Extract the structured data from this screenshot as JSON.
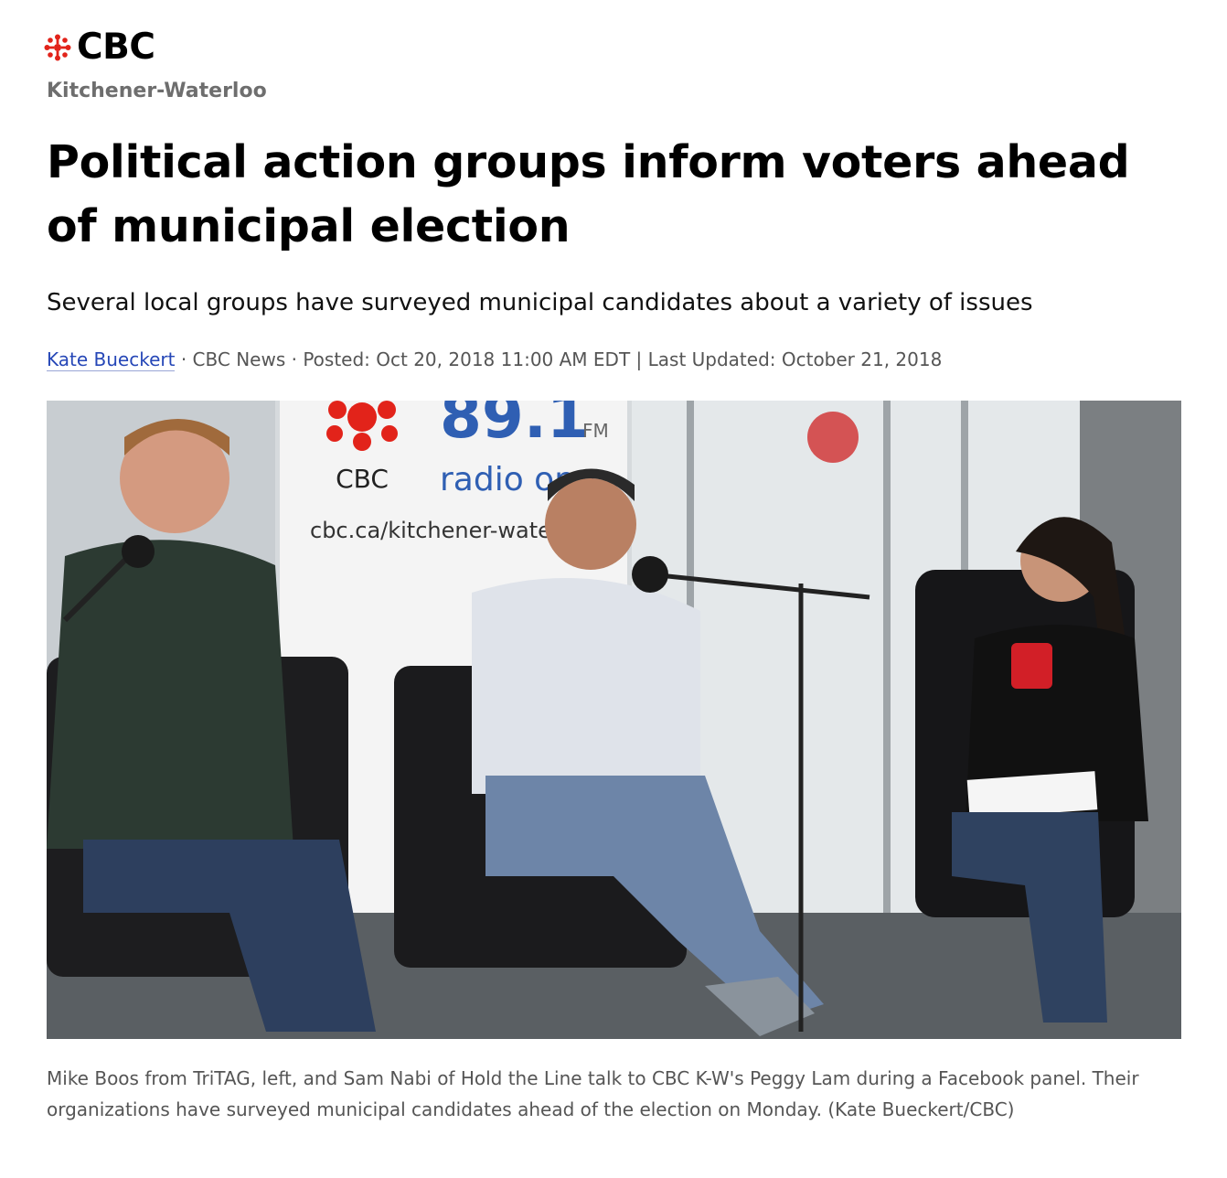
{
  "brand": {
    "logo_text": "CBC",
    "icon": "cbc-gem-icon",
    "red": "#e2231a"
  },
  "section": "Kitchener-Waterloo",
  "headline": "Political action groups inform voters ahead of municipal election",
  "deck": "Several local groups have surveyed municipal candidates about a variety of issues",
  "byline": {
    "author": "Kate Bueckert",
    "sep1": " · ",
    "outlet": "CBC News",
    "sep2": " · ",
    "posted": "Posted: Oct 20, 2018 11:00 AM EDT",
    "sep3": " | ",
    "updated": "Last Updated: October 21, 2018",
    "link_color": "#2647b7"
  },
  "photo": {
    "banner_cbc": "CBC",
    "banner_freq": "89.1",
    "banner_fm": "FM",
    "banner_radio": "radio one",
    "banner_url": "cbc.ca/kitchener-waterloo"
  },
  "caption": "Mike Boos from TriTAG, left, and Sam Nabi of Hold the Line talk to CBC K-W's Peggy Lam during a Facebook panel. Their organizations have surveyed municipal candidates ahead of the election on Monday. (Kate Bueckert/CBC)"
}
